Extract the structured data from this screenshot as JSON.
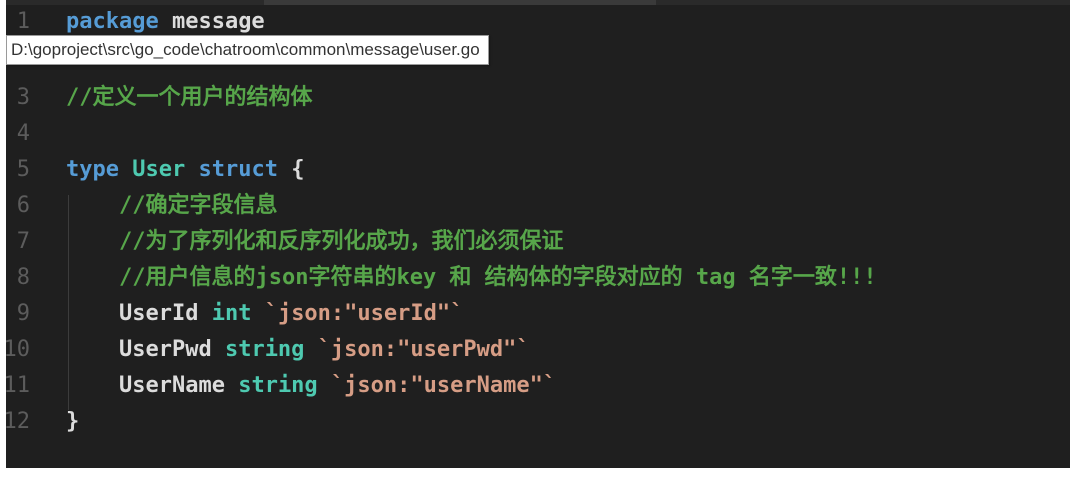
{
  "editor": {
    "tooltip_path": "D:\\goproject\\src\\go_code\\chatroom\\common\\message\\user.go",
    "lines": [
      {
        "num": "1",
        "tokens": [
          {
            "t": "package",
            "c": "kw"
          },
          {
            "t": " message",
            "c": "plain"
          }
        ]
      },
      {
        "num": "3",
        "tokens": [
          {
            "t": "//定义一个用户的结构体",
            "c": "cmt"
          }
        ]
      },
      {
        "num": "4",
        "tokens": []
      },
      {
        "num": "5",
        "tokens": [
          {
            "t": "type",
            "c": "kw"
          },
          {
            "t": " ",
            "c": "plain"
          },
          {
            "t": "User",
            "c": "type"
          },
          {
            "t": " ",
            "c": "plain"
          },
          {
            "t": "struct",
            "c": "kw"
          },
          {
            "t": " {",
            "c": "plain"
          }
        ]
      },
      {
        "num": "6",
        "tokens": [
          {
            "t": "    //确定字段信息",
            "c": "cmt"
          }
        ]
      },
      {
        "num": "7",
        "tokens": [
          {
            "t": "    //为了序列化和反序列化成功，我们必须保证",
            "c": "cmt"
          }
        ]
      },
      {
        "num": "8",
        "tokens": [
          {
            "t": "    //用户信息的json字符串的key 和 结构体的字段对应的 tag 名字一致!!!",
            "c": "cmt"
          }
        ]
      },
      {
        "num": "9",
        "tokens": [
          {
            "t": "    UserId",
            "c": "plain"
          },
          {
            "t": " ",
            "c": "plain"
          },
          {
            "t": "int",
            "c": "type"
          },
          {
            "t": " `json:\"userId\"`",
            "c": "str"
          }
        ]
      },
      {
        "num": "10",
        "tokens": [
          {
            "t": "    UserPwd",
            "c": "plain"
          },
          {
            "t": " ",
            "c": "plain"
          },
          {
            "t": "string",
            "c": "type"
          },
          {
            "t": " `json:\"userPwd\"`",
            "c": "str"
          }
        ]
      },
      {
        "num": "11",
        "tokens": [
          {
            "t": "    UserName",
            "c": "plain"
          },
          {
            "t": " ",
            "c": "plain"
          },
          {
            "t": "string",
            "c": "type"
          },
          {
            "t": " `json:\"userName\"`",
            "c": "str"
          }
        ]
      },
      {
        "num": "12",
        "tokens": [
          {
            "t": "}",
            "c": "plain"
          }
        ]
      }
    ]
  },
  "colors": {
    "background": "#1f1f1f",
    "keyword": "#569cd6",
    "type": "#4ec9b0",
    "string": "#d69d85",
    "comment": "#57a64a",
    "text": "#dcdcdc",
    "gutter": "#5c5c5c"
  }
}
